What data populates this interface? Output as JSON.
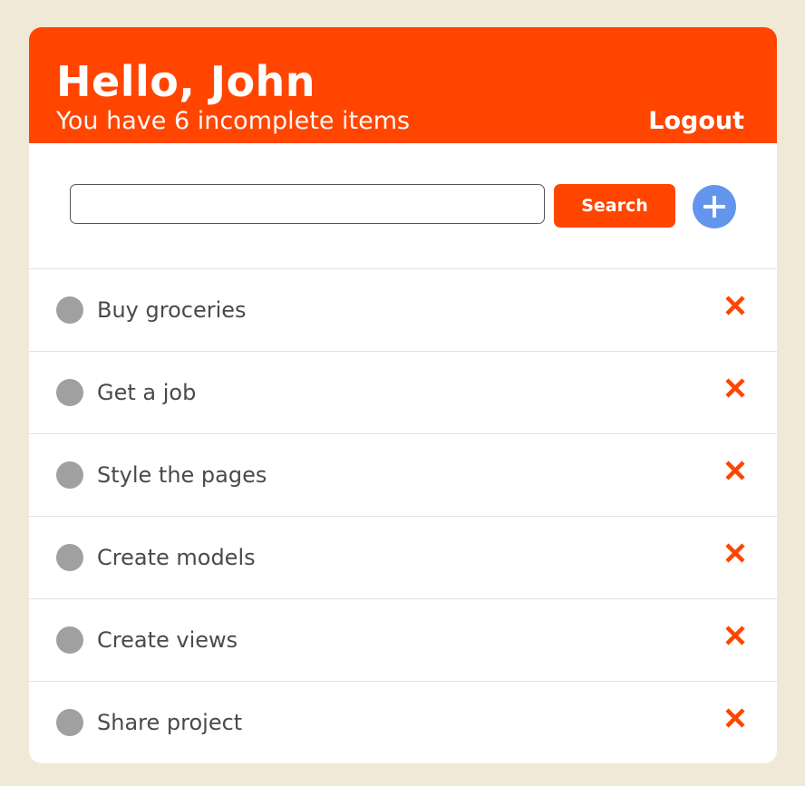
{
  "header": {
    "greeting": "Hello, John",
    "subtitle": "You have 6 incomplete items",
    "logout_label": "Logout"
  },
  "search": {
    "value": "",
    "placeholder": "",
    "button_label": "Search",
    "add_icon": "plus-icon"
  },
  "todos": [
    {
      "label": "Buy groceries",
      "status_icon": "circle-icon",
      "delete_icon": "x-icon"
    },
    {
      "label": "Get a job",
      "status_icon": "circle-icon",
      "delete_icon": "x-icon"
    },
    {
      "label": "Style the pages",
      "status_icon": "circle-icon",
      "delete_icon": "x-icon"
    },
    {
      "label": "Create models",
      "status_icon": "circle-icon",
      "delete_icon": "x-icon"
    },
    {
      "label": "Create views",
      "status_icon": "circle-icon",
      "delete_icon": "x-icon"
    },
    {
      "label": "Share project",
      "status_icon": "circle-icon",
      "delete_icon": "x-icon"
    }
  ],
  "colors": {
    "background": "#f1e9d7",
    "accent": "#ff4500",
    "add_button": "#6495ed",
    "check_circle": "#a0a0a0",
    "text": "#4a4a4a"
  }
}
